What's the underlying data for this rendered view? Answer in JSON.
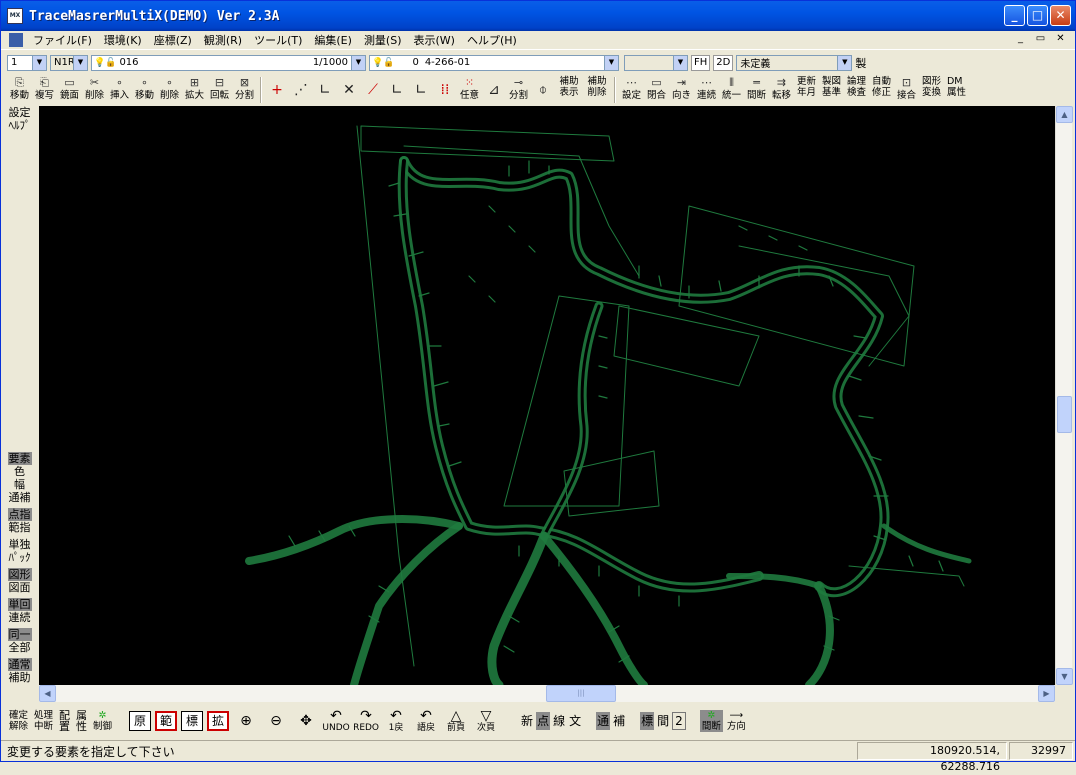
{
  "app": {
    "title": "TraceMasrerMultiX(DEMO) Ver 2.3A",
    "icon_label": "MX"
  },
  "window_buttons": {
    "minimize": "_",
    "maximize": "□",
    "close": "✕"
  },
  "menu": {
    "items": [
      "ファイル(F)",
      "環境(K)",
      "座標(Z)",
      "観測(R)",
      "ツール(T)",
      "編集(E)",
      "測量(S)",
      "表示(W)",
      "ヘルプ(H)"
    ],
    "mdi_buttons": [
      "_",
      "▭",
      "✕"
    ]
  },
  "toolbar1": {
    "combo1": "1",
    "combo2": "N1R",
    "layer1_value": "016",
    "scale_value": "1/1000",
    "layer2_code": "0",
    "layer2_value": "4-266-01",
    "empty_combo": "",
    "fh_label": "FH",
    "mode_label": "2D",
    "undefined_value": "未定義",
    "make_label": "製"
  },
  "toolbar2": {
    "left_buttons": [
      "移動",
      "複写",
      "鏡面",
      "削除",
      "挿入",
      "移動",
      "削除",
      "拡大",
      "回転",
      "分割"
    ],
    "tool_glyphs": [
      "+",
      "⋰",
      "∟",
      "✕",
      "⟋",
      "∟",
      "∟",
      "⁞⁞"
    ],
    "mid_labels": [
      "任意",
      "分割"
    ],
    "aux_buttons": [
      "補助\n表示",
      "補助\n削除"
    ],
    "right_buttons": [
      "設定",
      "閉合",
      "向き",
      "連続",
      "統一",
      "間断",
      "転移",
      "更新\n年月",
      "製図\n基準",
      "論理\n検査",
      "自動\n修正",
      "接合",
      "図形\n変換",
      "DM\n属性"
    ]
  },
  "sidebar": [
    {
      "label": "設定\nﾍﾙﾌﾟ",
      "highlight": false
    },
    {
      "label": "要素",
      "highlight": true
    },
    {
      "label": "色\n幅\n通補",
      "highlight": false
    },
    {
      "label": "点指",
      "highlight": true
    },
    {
      "label": "範指",
      "highlight": false
    },
    {
      "label": "単独\nﾊﾟｯｸ",
      "highlight": false
    },
    {
      "label": "図形",
      "highlight": true
    },
    {
      "label": "図面",
      "highlight": false
    },
    {
      "label": "単回",
      "highlight": true
    },
    {
      "label": "連続",
      "highlight": false
    },
    {
      "label": "同一",
      "highlight": true
    },
    {
      "label": "全部",
      "highlight": false
    },
    {
      "label": "通常",
      "highlight": true
    },
    {
      "label": "補助",
      "highlight": false
    }
  ],
  "bottombar": {
    "left_buttons": [
      "確定\n解除",
      "処理\n中断",
      "配\n置",
      "属\n性",
      "制御"
    ],
    "boxes": [
      "原",
      "範",
      "標",
      "拡"
    ],
    "nav": [
      {
        "icon": "⊕",
        "label": ""
      },
      {
        "icon": "⊖",
        "label": ""
      },
      {
        "icon": "✥",
        "label": ""
      },
      {
        "icon": "↶",
        "label": "UNDO"
      },
      {
        "icon": "↷",
        "label": "REDO"
      },
      {
        "icon": "↶",
        "label": "1戻"
      },
      {
        "icon": "↶",
        "label": "語戻"
      },
      {
        "icon": "△",
        "label": "前頁"
      },
      {
        "icon": "▽",
        "label": "次頁"
      }
    ],
    "toggles1": [
      {
        "label": "新",
        "on": false
      },
      {
        "label": "点",
        "on": true
      },
      {
        "label": "線",
        "on": false
      },
      {
        "label": "文",
        "on": false
      }
    ],
    "toggles2": [
      {
        "label": "通",
        "on": true
      },
      {
        "label": "補",
        "on": false
      }
    ],
    "toggles3": [
      {
        "label": "標",
        "on": true
      },
      {
        "label": "間",
        "on": false
      },
      {
        "label": "2",
        "on": false
      }
    ],
    "right_buttons": [
      "間断",
      "方向"
    ]
  },
  "status": {
    "message": "変更する要素を指定して下さい",
    "coords": "180920.514,　62288.716",
    "count": "32997"
  },
  "colors": {
    "canvas_bg": "#000000",
    "drawing_line": "#1f7a3e"
  }
}
